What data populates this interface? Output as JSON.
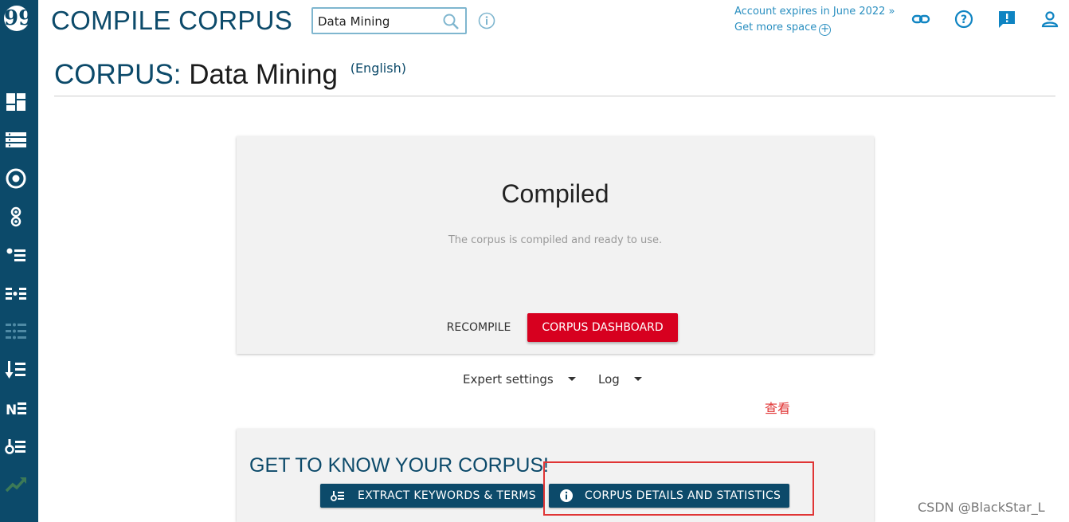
{
  "sidebar": {
    "logo_glyph": "99",
    "icons": [
      "dashboard-icon",
      "list-icon",
      "concordance-icon",
      "collocations-icon",
      "word-list-icon",
      "thesaurus-icon",
      "word-sketch-icon",
      "keywords-icon",
      "ngrams-icon",
      "terms-icon",
      "trends-icon"
    ]
  },
  "header": {
    "title": "COMPILE CORPUS",
    "search_value": "Data Mining",
    "account_expiry": "Account expires in June 2022 »",
    "get_more_space": "Get more space"
  },
  "page": {
    "prefix": "CORPUS:",
    "corpus_name": "Data Mining",
    "language": "(English)"
  },
  "status_card": {
    "status": "Compiled",
    "message": "The corpus is compiled and ready to use.",
    "recompile_label": "RECOMPILE",
    "dashboard_label": "CORPUS DASHBOARD"
  },
  "dropdowns": {
    "expert_settings": "Expert settings",
    "log": "Log"
  },
  "annotation": {
    "text": "查看"
  },
  "know_card": {
    "title": "GET TO KNOW YOUR CORPUS!",
    "extract_label": "EXTRACT KEYWORDS & TERMS",
    "details_label": "CORPUS DETAILS AND STATISTICS"
  },
  "watermark": "CSDN @BlackStar_L",
  "colors": {
    "primary": "#0c4a6a",
    "accent_red": "#d7001f",
    "link_blue": "#2a8fc0",
    "annotation_red": "#e03535"
  }
}
